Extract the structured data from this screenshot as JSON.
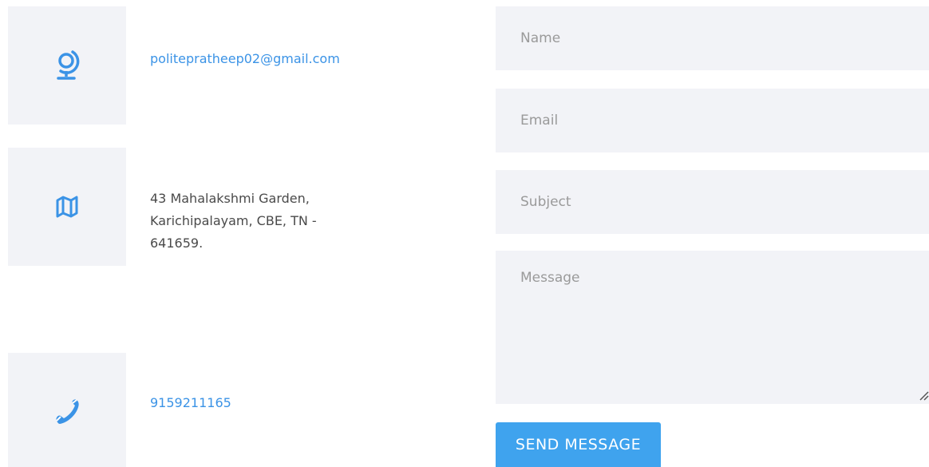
{
  "contact": {
    "email": "politepratheep02@gmail.com",
    "address_lines": [
      "43 Mahalakshmi Garden,",
      "Karichipalayam, CBE, TN -",
      "641659."
    ],
    "phone": "9159211165"
  },
  "icons": {
    "email": "globe-icon",
    "address": "map-icon",
    "phone": "phone-icon"
  },
  "form": {
    "name_placeholder": "Name",
    "email_placeholder": "Email",
    "subject_placeholder": "Subject",
    "message_placeholder": "Message",
    "submit_label": "SEND MESSAGE"
  },
  "colors": {
    "accent": "#3b93e6",
    "button": "#3fa3ee",
    "panel": "#f2f3f7"
  }
}
